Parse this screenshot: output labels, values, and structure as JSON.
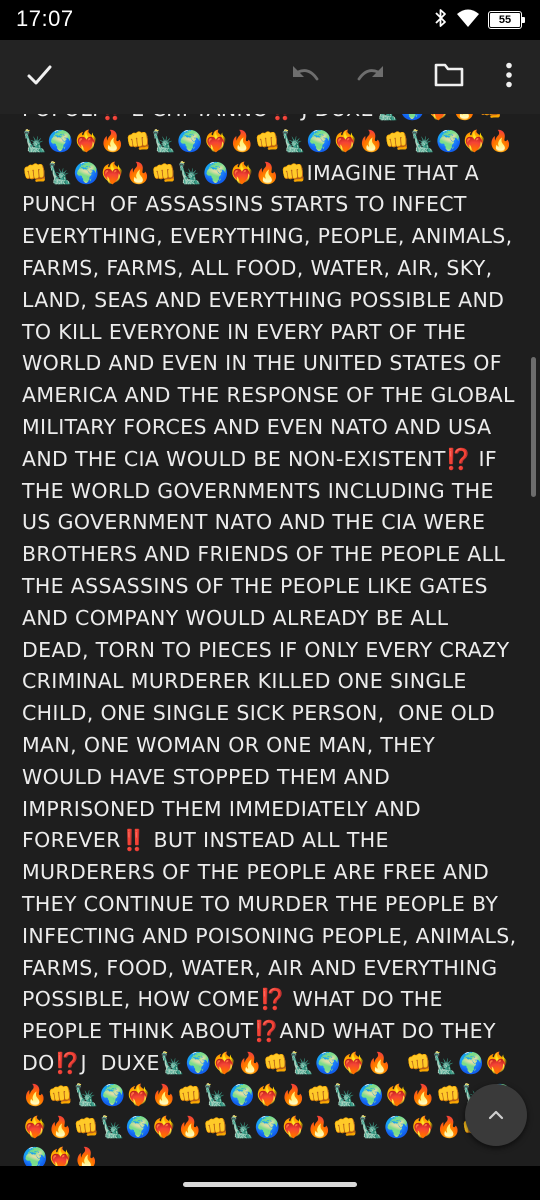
{
  "status_bar": {
    "time": "17:07",
    "battery_level": "55",
    "icons": [
      "bluetooth-icon",
      "wifi-icon",
      "battery-icon"
    ]
  },
  "toolbar": {
    "buttons": [
      "check-icon",
      "undo-icon",
      "redo-icon",
      "folder-icon",
      "more-vert-icon"
    ]
  },
  "editor": {
    "body": "POPOLI‼️ E CHI TANNO‼️ J DUXE🗽🌍❤️‍🔥🔥👊🗽🌍❤️‍🔥🔥👊🗽🌍❤️‍🔥🔥👊🗽🌍❤️‍🔥🔥👊🗽🌍❤️‍🔥🔥👊🗽🌍❤️‍🔥🔥👊🗽🌍❤️‍🔥🔥👊IMAGINE THAT A PUNCH  OF ASSASSINS STARTS TO INFECT EVERYTHING, EVERYTHING, PEOPLE, ANIMALS, FARMS, FARMS, ALL FOOD, WATER, AIR, SKY, LAND, SEAS AND EVERYTHING POSSIBLE AND TO KILL EVERYONE IN EVERY PART OF THE WORLD AND EVEN IN THE UNITED STATES OF AMERICA AND THE RESPONSE OF THE GLOBAL MILITARY FORCES AND EVEN NATO AND USA AND THE CIA WOULD BE NON-EXISTENT⁉️ IF THE WORLD GOVERNMENTS INCLUDING THE US GOVERNMENT NATO AND THE CIA WERE BROTHERS AND FRIENDS OF THE PEOPLE ALL THE ASSASSINS OF THE PEOPLE LIKE GATES AND COMPANY WOULD ALREADY BE ALL DEAD, TORN TO PIECES IF ONLY EVERY CRAZY CRIMINAL MURDERER KILLED ONE SINGLE CHILD, ONE SINGLE SICK PERSON,  ONE OLD MAN, ONE WOMAN OR ONE MAN, THEY WOULD HAVE STOPPED THEM AND IMPRISONED THEM IMMEDIATELY AND FOREVER‼️ BUT INSTEAD ALL THE MURDERERS OF THE PEOPLE ARE FREE AND THEY CONTINUE TO MURDER THE PEOPLE BY INFECTING AND POISONING PEOPLE, ANIMALS, FARMS, FOOD, WATER, AIR AND EVERYTHING POSSIBLE, HOW COME⁉️ WHAT DO THE PEOPLE THINK ABOUT⁉️AND WHAT DO THEY DO⁉️J  DUXE🗽🌍❤️‍🔥🔥👊🗽🌍❤️‍🔥🔥  👊🗽🌍❤️‍🔥🔥👊🗽🌍❤️‍🔥🔥👊🗽🌍❤️‍🔥🔥👊🗽🌍❤️‍🔥🔥👊🗽🌍❤️‍🔥🔥👊🗽🌍❤️‍🔥🔥👊🗽🌍❤️‍🔥🔥👊🗽🌍❤️‍🔥🔥👊🗽🌍❤️‍🔥🔥"
  },
  "fab": {
    "icon": "chevron-up-icon"
  },
  "colors": {
    "background": "#1e1e1e",
    "toolbar": "#232323",
    "text": "#ececec",
    "status_bar": "#000000"
  }
}
